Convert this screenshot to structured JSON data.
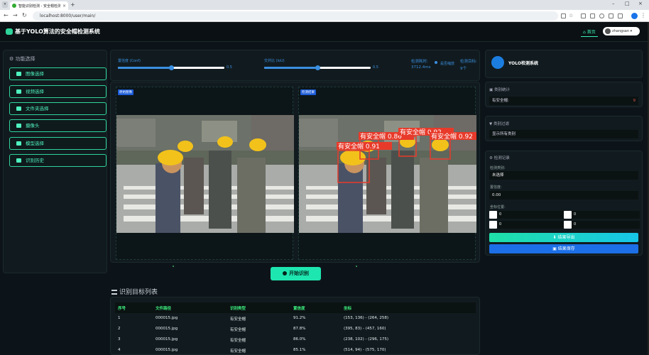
{
  "browser": {
    "tab_title": "智能识别检测 - 安全帽检测系统",
    "url": "localhost:8000/user/main/"
  },
  "app": {
    "title": "基于YOLO算法的安全帽检测系统",
    "home_label": "首页",
    "user_name": "zhangsan"
  },
  "sidebar": {
    "heading": "功能选择",
    "items": [
      {
        "label": "图像选择"
      },
      {
        "label": "视频选择"
      },
      {
        "label": "文件夹选择"
      },
      {
        "label": "摄像头"
      },
      {
        "label": "模型选择"
      },
      {
        "label": "识别历史"
      }
    ]
  },
  "controls": {
    "conf_label": "置信度 (Conf)",
    "conf_value": "0.5",
    "conf_fraction": 0.5,
    "iou_label": "交并比 (IoU)",
    "iou_value": "0.5",
    "iou_fraction": 0.5,
    "time_label": "检测耗时:",
    "time_value": "3712.4ms",
    "scaled_label": "是否缩放",
    "target_label": "检测目标:",
    "target_value": "9个"
  },
  "images": {
    "original_tag": "原始图像",
    "result_tag": "检测结果",
    "detections": [
      {
        "text": "有安全帽 0.86"
      },
      {
        "text": "有安全帽 0.92"
      },
      {
        "text": "有安全帽 0.91"
      },
      {
        "text": "有安全帽 0.92"
      }
    ]
  },
  "start_button": "开始识别",
  "results": {
    "title": "识别目标列表",
    "columns": [
      "序号",
      "文件路径",
      "识别类型",
      "置信度",
      "坐标"
    ],
    "rows": [
      [
        "1",
        "000015.jpg",
        "有安全帽",
        "91.2%",
        "(153, 136) - (264, 258)"
      ],
      [
        "2",
        "000015.jpg",
        "有安全帽",
        "87.8%",
        "(395, 83) - (457, 160)"
      ],
      [
        "3",
        "000015.jpg",
        "有安全帽",
        "86.0%",
        "(238, 102) - (296, 175)"
      ],
      [
        "4",
        "000015.jpg",
        "有安全帽",
        "85.1%",
        "(514, 94) - (575, 170)"
      ]
    ]
  },
  "right": {
    "system_title": "YOLO检测系统",
    "stats_heading": "类别统计",
    "stats_row_label": "有安全帽:",
    "stats_row_count": "9",
    "filter_heading": "类别过滤",
    "filter_value": "显示所有类别",
    "record_heading": "检测记录",
    "class_label": "检测类别:",
    "class_value": "未选择",
    "conf_label": "置信度:",
    "conf_value": "0.00",
    "coord_label": "坐标位置:",
    "coord_values": [
      "0",
      "0",
      "0",
      "0"
    ],
    "export_button": "结果导出",
    "save_button": "结果保存"
  },
  "colors": {
    "accent_green": "#2fd39a",
    "accent_blue": "#3b8fe0",
    "background": "#0d1419",
    "detection_red": "#e83a2a"
  }
}
